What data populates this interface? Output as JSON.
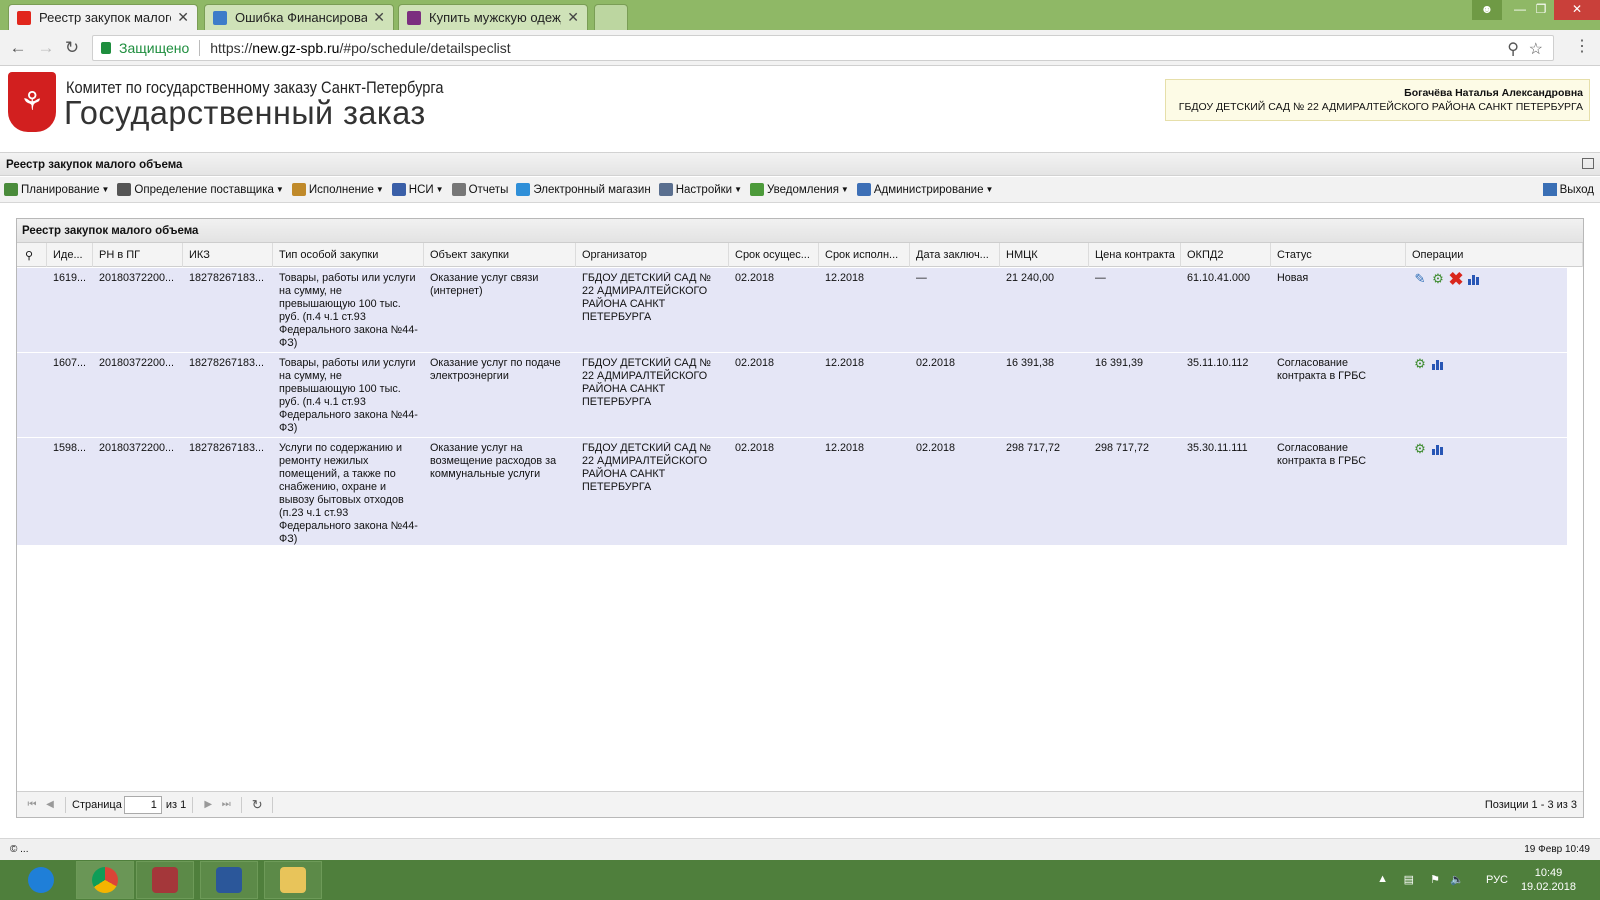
{
  "browser": {
    "tabs": [
      {
        "title": "Реестр закупок малого объема",
        "favicon_color": "#e1261c",
        "active": true
      },
      {
        "title": "Ошибка Финансирования",
        "favicon_color": "#3d7cc9",
        "active": false
      },
      {
        "title": "Купить мужскую одежду",
        "favicon_color": "#7b2f7f",
        "active": false
      }
    ],
    "secure_label": "Защищено",
    "url_scheme": "https://",
    "url_host": "new.gz-spb.ru",
    "url_path": "/#po/schedule/detailspeclist"
  },
  "header": {
    "org_line1": "Комитет по государственному заказу Санкт-Петербурга",
    "org_line2": "Государственный заказ",
    "user_name": "Богачёва Наталья Александровна",
    "user_org": "ГБДОУ ДЕТСКИЙ САД № 22 АДМИРАЛТЕЙСКОГО РАЙОНА САНКТ ПЕТЕРБУРГА"
  },
  "panel": {
    "title": "Реестр закупок малого объема",
    "menu": [
      {
        "label": "Планирование",
        "icon": "planning-icon",
        "color": "#4a8b3b",
        "dropdown": true
      },
      {
        "label": "Определение поставщика",
        "icon": "supplier-gear-icon",
        "color": "#555555",
        "dropdown": true
      },
      {
        "label": "Исполнение",
        "icon": "execution-icon",
        "color": "#c08a2a",
        "dropdown": true
      },
      {
        "label": "НСИ",
        "icon": "book-icon",
        "color": "#3a5fa8",
        "dropdown": true
      },
      {
        "label": "Отчеты",
        "icon": "report-icon",
        "color": "#777777",
        "dropdown": false
      },
      {
        "label": "Электронный магазин",
        "icon": "cart-icon",
        "color": "#2f8fd8",
        "dropdown": false
      },
      {
        "label": "Настройки",
        "icon": "wrench-icon",
        "color": "#5a6f8f",
        "dropdown": true
      },
      {
        "label": "Уведомления",
        "icon": "notification-icon",
        "color": "#4c9a3a",
        "dropdown": true
      },
      {
        "label": "Администрирование",
        "icon": "admin-user-icon",
        "color": "#3d6fb6",
        "dropdown": true
      }
    ],
    "logout_label": "Выход"
  },
  "grid": {
    "title": "Реестр закупок малого объема",
    "columns": [
      "Иде...",
      "РН в ПГ",
      "ИКЗ",
      "Тип особой закупки",
      "Объект закупки",
      "Организатор",
      "Срок осущес...",
      "Срок исполн...",
      "Дата заключ...",
      "НМЦК",
      "Цена контракта",
      "ОКПД2",
      "Статус",
      "Операции"
    ],
    "rows": [
      {
        "id": "1619...",
        "rn": "20180372200...",
        "ikz": "18278267183...",
        "type": "Товары, работы или услуги на сумму, не превышающую 100 тыс. руб. (п.4 ч.1 ст.93 Федерального закона №44-ФЗ)",
        "object": "Оказание услуг связи (интернет)",
        "organizer": "ГБДОУ ДЕТСКИЙ САД № 22 АДМИРАЛТЕЙСКОГО РАЙОНА САНКТ ПЕТЕРБУРГА",
        "period": "02.2018",
        "exec": "12.2018",
        "date": "—",
        "nmck": "21 240,00",
        "price": "—",
        "okpd": "61.10.41.000",
        "status": "Новая",
        "ops": [
          "edit",
          "approve",
          "delete",
          "chart"
        ]
      },
      {
        "id": "1607...",
        "rn": "20180372200...",
        "ikz": "18278267183...",
        "type": "Товары, работы или услуги на сумму, не превышающую 100 тыс. руб. (п.4 ч.1 ст.93 Федерального закона №44-ФЗ)",
        "object": "Оказание услуг по подаче электроэнергии",
        "organizer": "ГБДОУ ДЕТСКИЙ САД № 22 АДМИРАЛТЕЙСКОГО РАЙОНА САНКТ ПЕТЕРБУРГА",
        "period": "02.2018",
        "exec": "12.2018",
        "date": "02.2018",
        "nmck": "16 391,38",
        "price": "16 391,39",
        "okpd": "35.11.10.112",
        "status": "Согласование контракта в ГРБС",
        "ops": [
          "approve",
          "chart"
        ]
      },
      {
        "id": "1598...",
        "rn": "20180372200...",
        "ikz": "18278267183...",
        "type": "Услуги по содержанию и ремонту нежилых помещений, а также по снабжению, охране и вывозу бытовых отходов (п.23 ч.1 ст.93 Федерального закона №44-ФЗ)",
        "object": "Оказание услуг на возмещение расходов за коммунальные услуги",
        "organizer": "ГБДОУ ДЕТСКИЙ САД № 22 АДМИРАЛТЕЙСКОГО РАЙОНА САНКТ ПЕТЕРБУРГА",
        "period": "02.2018",
        "exec": "12.2018",
        "date": "02.2018",
        "nmck": "298 717,72",
        "price": "298 717,72",
        "okpd": "35.30.11.111",
        "status": "Согласование контракта в ГРБС",
        "ops": [
          "approve",
          "chart"
        ]
      }
    ],
    "pager": {
      "page_label": "Страница",
      "page": "1",
      "of_label": "из 1",
      "info": "Позиции 1 - 3 из 3"
    }
  },
  "footer": {
    "left": "© ...",
    "right": "19 Февр 10:49"
  },
  "taskbar": {
    "lang": "РУС",
    "time": "10:49",
    "date": "19.02.2018"
  }
}
